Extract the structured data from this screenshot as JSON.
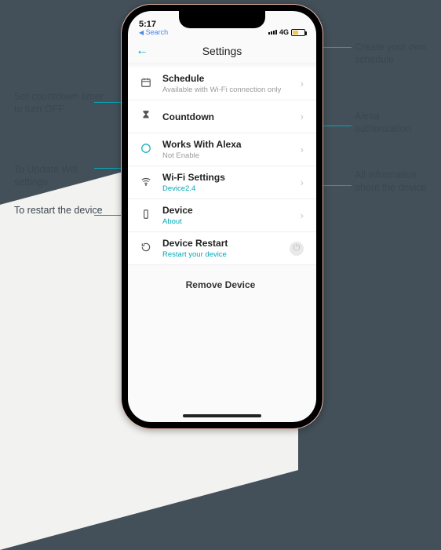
{
  "status": {
    "time": "5:17",
    "back": "Search",
    "network": "4G"
  },
  "header": {
    "title": "Settings"
  },
  "rows": {
    "schedule": {
      "label": "Schedule",
      "sub": "Available with Wi-Fi connection only"
    },
    "countdown": {
      "label": "Countdown"
    },
    "alexa": {
      "label": "Works With Alexa",
      "sub": "Not Enable"
    },
    "wifi": {
      "label": "Wi-Fi Settings",
      "sub": "Device2.4"
    },
    "device": {
      "label": "Device",
      "sub": "About"
    },
    "restart": {
      "label": "Device Restart",
      "sub": "Restart your device"
    },
    "remove": {
      "label": "Remove Device"
    }
  },
  "annotations": {
    "schedule": "Create your own schedule",
    "countdown": "Set countdown timer to turn OFF",
    "alexa": "Alexa authorization",
    "wifi": "To Update Wifi settings",
    "device": "All information about the device",
    "restart": "To restart the device"
  },
  "colors": {
    "accent": "#06a8b6",
    "bgDark": "#435059",
    "bgLight": "#f2f2f0"
  }
}
